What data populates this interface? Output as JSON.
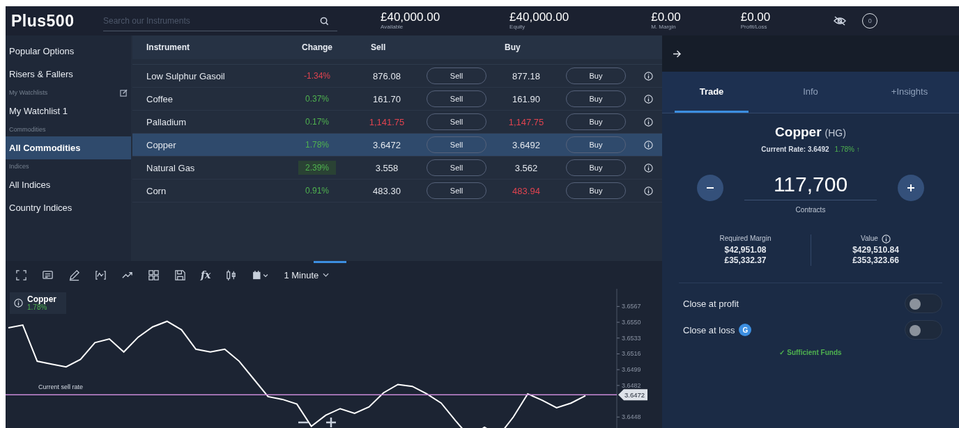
{
  "header": {
    "logo": "Plus500",
    "search": {
      "placeholder": "Search our Instruments"
    },
    "stats": [
      {
        "value": "£40,000.00",
        "label": "Available"
      },
      {
        "value": "£40,000.00",
        "label": "Equity"
      },
      {
        "value": "£0.00",
        "label": "M. Margin"
      },
      {
        "value": "£0.00",
        "label": "Profit/Loss"
      }
    ],
    "notifications": "0"
  },
  "sidebar": {
    "items": [
      {
        "kind": "item",
        "label": "Popular Options",
        "selected": false
      },
      {
        "kind": "item",
        "label": "Risers & Fallers",
        "selected": false
      },
      {
        "kind": "heading",
        "label": "My Watchlists",
        "editable": true
      },
      {
        "kind": "item",
        "label": "My Watchlist 1",
        "selected": false
      },
      {
        "kind": "heading",
        "label": "Commodities",
        "editable": false
      },
      {
        "kind": "item",
        "label": "All Commodities",
        "selected": true
      },
      {
        "kind": "heading",
        "label": "Indices",
        "editable": false
      },
      {
        "kind": "item",
        "label": "All Indices",
        "selected": false
      },
      {
        "kind": "item",
        "label": "Country Indices",
        "selected": false
      }
    ]
  },
  "table": {
    "columns": [
      "Instrument",
      "Change",
      "Sell",
      "Buy"
    ],
    "rows": [
      {
        "instrument": "Low Sulphur Gasoil",
        "change": {
          "text": "-1.34%",
          "color": "#e0434f"
        },
        "change_flash": false,
        "sell": {
          "text": "876.08",
          "color": "#e4e8ee"
        },
        "sell_button": "Sell",
        "buy": {
          "text": "877.18",
          "color": "#e4e8ee"
        },
        "buy_button": "Buy",
        "selected": false
      },
      {
        "instrument": "Coffee",
        "change": {
          "text": "0.37%",
          "color": "#4fb24f"
        },
        "change_flash": false,
        "sell": {
          "text": "161.70",
          "color": "#e4e8ee"
        },
        "sell_button": "Sell",
        "buy": {
          "text": "161.90",
          "color": "#e4e8ee"
        },
        "buy_button": "Buy",
        "selected": false
      },
      {
        "instrument": "Palladium",
        "change": {
          "text": "0.17%",
          "color": "#4fb24f"
        },
        "change_flash": false,
        "sell": {
          "text": "1,141.75",
          "color": "#e0434f"
        },
        "sell_button": "Sell",
        "buy": {
          "text": "1,147.75",
          "color": "#e0434f"
        },
        "buy_button": "Buy",
        "selected": false
      },
      {
        "instrument": "Copper",
        "change": {
          "text": "1.78%",
          "color": "#4fb24f"
        },
        "change_flash": false,
        "sell": {
          "text": "3.6472",
          "color": "#e4e8ee"
        },
        "sell_button": "Sell",
        "buy": {
          "text": "3.6492",
          "color": "#e4e8ee"
        },
        "buy_button": "Buy",
        "selected": true
      },
      {
        "instrument": "Natural Gas",
        "change": {
          "text": "2.39%",
          "color": "#4fb24f"
        },
        "change_flash": true,
        "sell": {
          "text": "3.558",
          "color": "#e4e8ee"
        },
        "sell_button": "Sell",
        "buy": {
          "text": "3.562",
          "color": "#e4e8ee"
        },
        "buy_button": "Buy",
        "selected": false
      },
      {
        "instrument": "Corn",
        "change": {
          "text": "0.91%",
          "color": "#4fb24f"
        },
        "change_flash": false,
        "sell": {
          "text": "483.30",
          "color": "#e4e8ee"
        },
        "sell_button": "Sell",
        "buy": {
          "text": "483.94",
          "color": "#e0434f"
        },
        "buy_button": "Buy",
        "selected": false
      }
    ]
  },
  "chart_panel": {
    "function_icon": "fx",
    "timeframe": "1 Minute",
    "legend_change": "1.78%",
    "price_marker": "3.6472",
    "chart_data": {
      "type": "line",
      "ylim": [
        3.641,
        3.6586
      ],
      "yticks": [
        {
          "value": 3.6567,
          "label": "3.6567"
        },
        {
          "value": 3.655,
          "label": "3.6550"
        },
        {
          "value": 3.6533,
          "label": "3.6533"
        },
        {
          "value": 3.6516,
          "label": "3.6516"
        },
        {
          "value": 3.6499,
          "label": "3.6499"
        },
        {
          "value": 3.6482,
          "label": "3.6482"
        },
        {
          "value": 3.6448,
          "label": "3.6448"
        }
      ],
      "series": [
        {
          "name": "Copper",
          "color": "#ffffff",
          "values": [
            3.6544,
            3.6547,
            3.6508,
            3.6505,
            3.6502,
            3.651,
            3.6528,
            3.6532,
            3.6518,
            3.6534,
            3.6545,
            3.6551,
            3.6542,
            3.6521,
            3.6518,
            3.6521,
            3.6508,
            3.6489,
            3.647,
            3.6467,
            3.6462,
            3.6438,
            3.645,
            3.6457,
            3.6452,
            3.6459,
            3.6474,
            3.6483,
            3.6481,
            3.6473,
            3.6463,
            3.6444,
            3.6426,
            3.6437,
            3.6428,
            3.6448,
            3.6473,
            3.6466,
            3.6458,
            3.6463,
            3.6471
          ]
        }
      ],
      "ref_lines": [
        {
          "axis": "y",
          "value": 3.6472,
          "label": "Current sell rate",
          "color": "#c98ad8"
        }
      ]
    }
  },
  "trade_panel": {
    "tabs": [
      {
        "label": "Trade",
        "selected": true
      },
      {
        "label": "Info",
        "selected": false
      },
      {
        "label": "+Insights",
        "selected": false
      }
    ],
    "instrument": "Copper",
    "symbol": "(HG)",
    "rate_label": "Current Rate: 3.6492",
    "rate_change": "1.78% ↑",
    "amount": "117,700",
    "amount_unit": "Contracts",
    "figures": [
      {
        "label": "Required Margin",
        "info": false,
        "usd": "$42,951.08",
        "gbp": "£35,332.37"
      },
      {
        "label": "Value",
        "info": true,
        "usd": "$429,510.84",
        "gbp": "£353,323.66"
      }
    ],
    "toggles": [
      {
        "label": "Close at profit",
        "on": false
      },
      {
        "label": "Close at loss",
        "badge": "G",
        "on": false
      }
    ],
    "funds_status": "✓ Sufficient Funds"
  }
}
